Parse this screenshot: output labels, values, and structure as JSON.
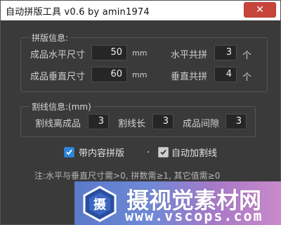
{
  "window": {
    "title": "自动拼版工具 v0.6   by amin1974",
    "close_glyph": "✕"
  },
  "layout_group": {
    "title": "拼版信息:",
    "product_width": {
      "label": "成品水平尺寸",
      "value": "50",
      "unit": "mm"
    },
    "product_height": {
      "label": "成品垂直尺寸",
      "value": "60",
      "unit": "mm"
    },
    "h_count": {
      "label": "水平共拼",
      "value": "3",
      "unit": "个"
    },
    "v_count": {
      "label": "垂直共拼",
      "value": "4",
      "unit": "个"
    }
  },
  "cutline_group": {
    "title": "割线信息:(mm)",
    "offset": {
      "label": "割线离成品",
      "value": "3"
    },
    "length": {
      "label": "割线长",
      "value": "3"
    },
    "gap": {
      "label": "成品间隙",
      "value": "3"
    }
  },
  "options": {
    "with_content": {
      "label": "带内容拼版",
      "checked": true
    },
    "separator": ".",
    "auto_cutline": {
      "label": "自动加割线",
      "checked": true
    }
  },
  "note": "注:水平与垂直尺寸需>0, 拼数需≥1, 其它值需≥0",
  "watermark": {
    "text": "摄视觉素材网",
    "url": "www.vscops.com",
    "logo_char": "摄"
  },
  "colors": {
    "checkbox_accent": "#2f86d8",
    "close_button": "#c8453b"
  }
}
